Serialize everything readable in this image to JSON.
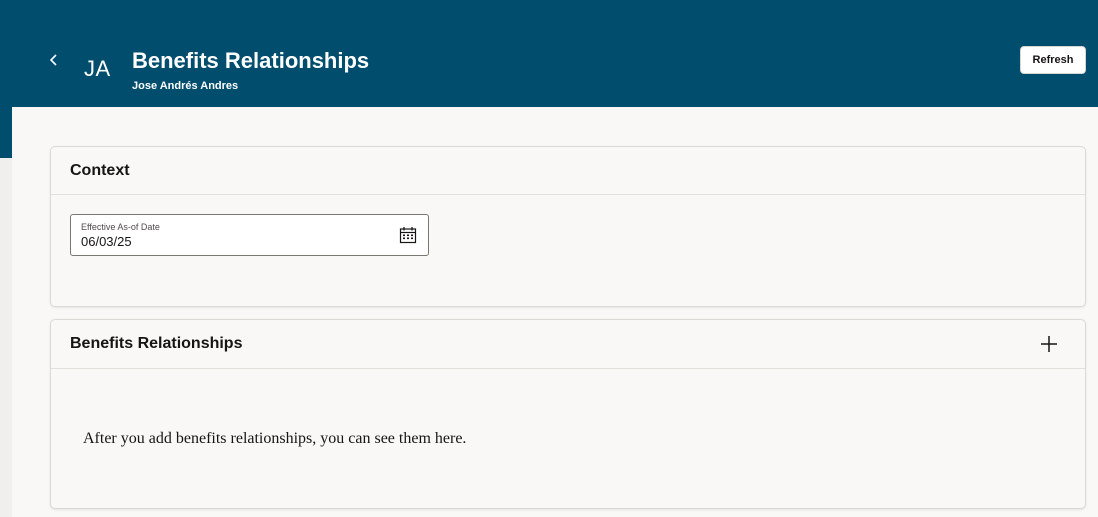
{
  "header": {
    "back_icon": "chevron-left-icon",
    "initials": "JA",
    "title": "Benefits Relationships",
    "subtitle": "Jose Andrés Andres",
    "refresh_label": "Refresh",
    "background_color": "#004d6e"
  },
  "context_card": {
    "title": "Context",
    "date_field": {
      "label": "Effective As-of Date",
      "value": "06/03/25",
      "icon": "calendar-icon"
    }
  },
  "relationships_card": {
    "title": "Benefits Relationships",
    "add_icon": "plus-icon",
    "empty_message": "After you add benefits relationships, you can see them here."
  }
}
